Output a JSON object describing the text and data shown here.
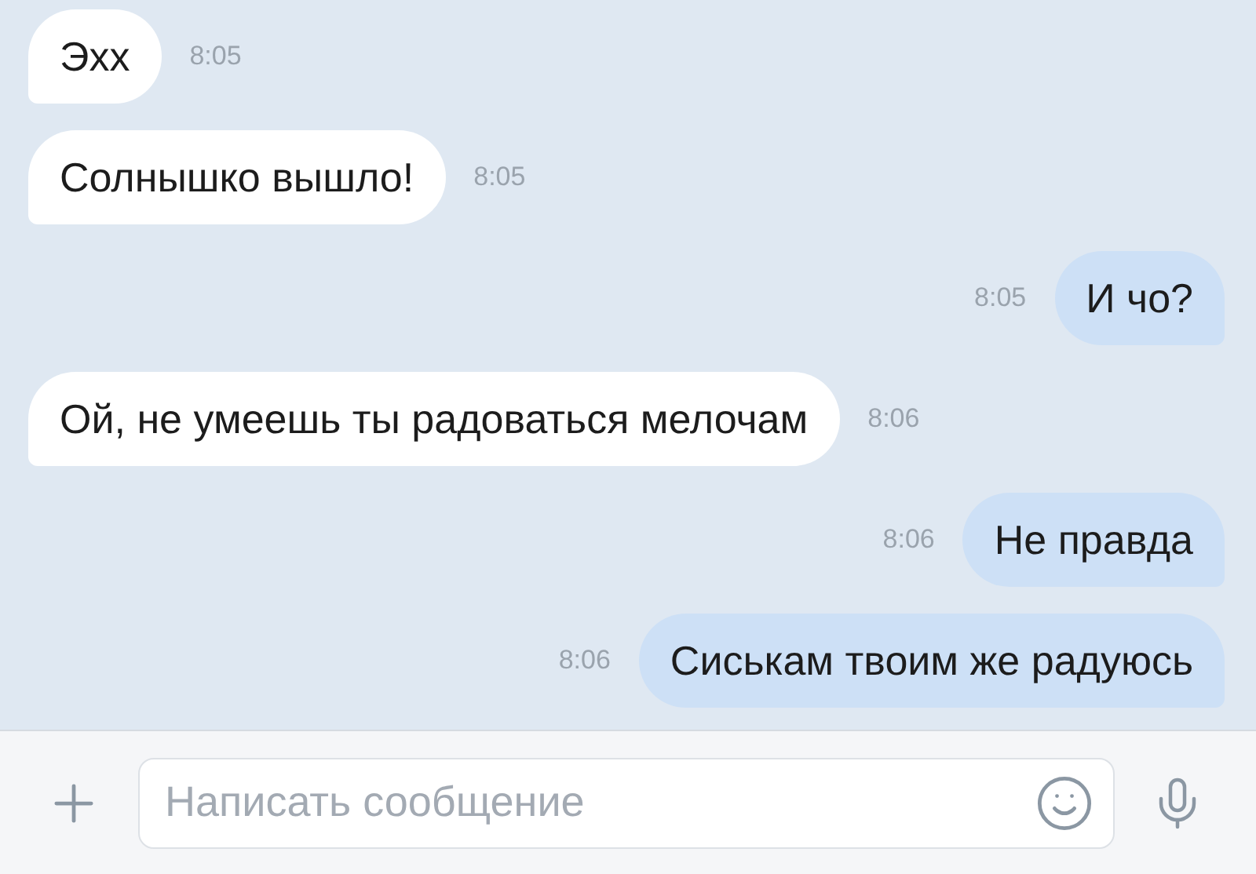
{
  "messages": [
    {
      "kind": "incoming",
      "text": "Эхх",
      "time": "8:05"
    },
    {
      "kind": "incoming",
      "text": "Солнышко вышло!",
      "time": "8:05"
    },
    {
      "kind": "outgoing",
      "text": "И чо?",
      "time": "8:05"
    },
    {
      "kind": "incoming",
      "text": "Ой, не умеешь ты радоваться мелочам",
      "time": "8:06"
    },
    {
      "kind": "outgoing",
      "text": "Не правда",
      "time": "8:06"
    },
    {
      "kind": "outgoing",
      "text": "Сиськам твоим же радуюсь",
      "time": "8:06"
    }
  ],
  "composer": {
    "placeholder": "Написать сообщение"
  }
}
